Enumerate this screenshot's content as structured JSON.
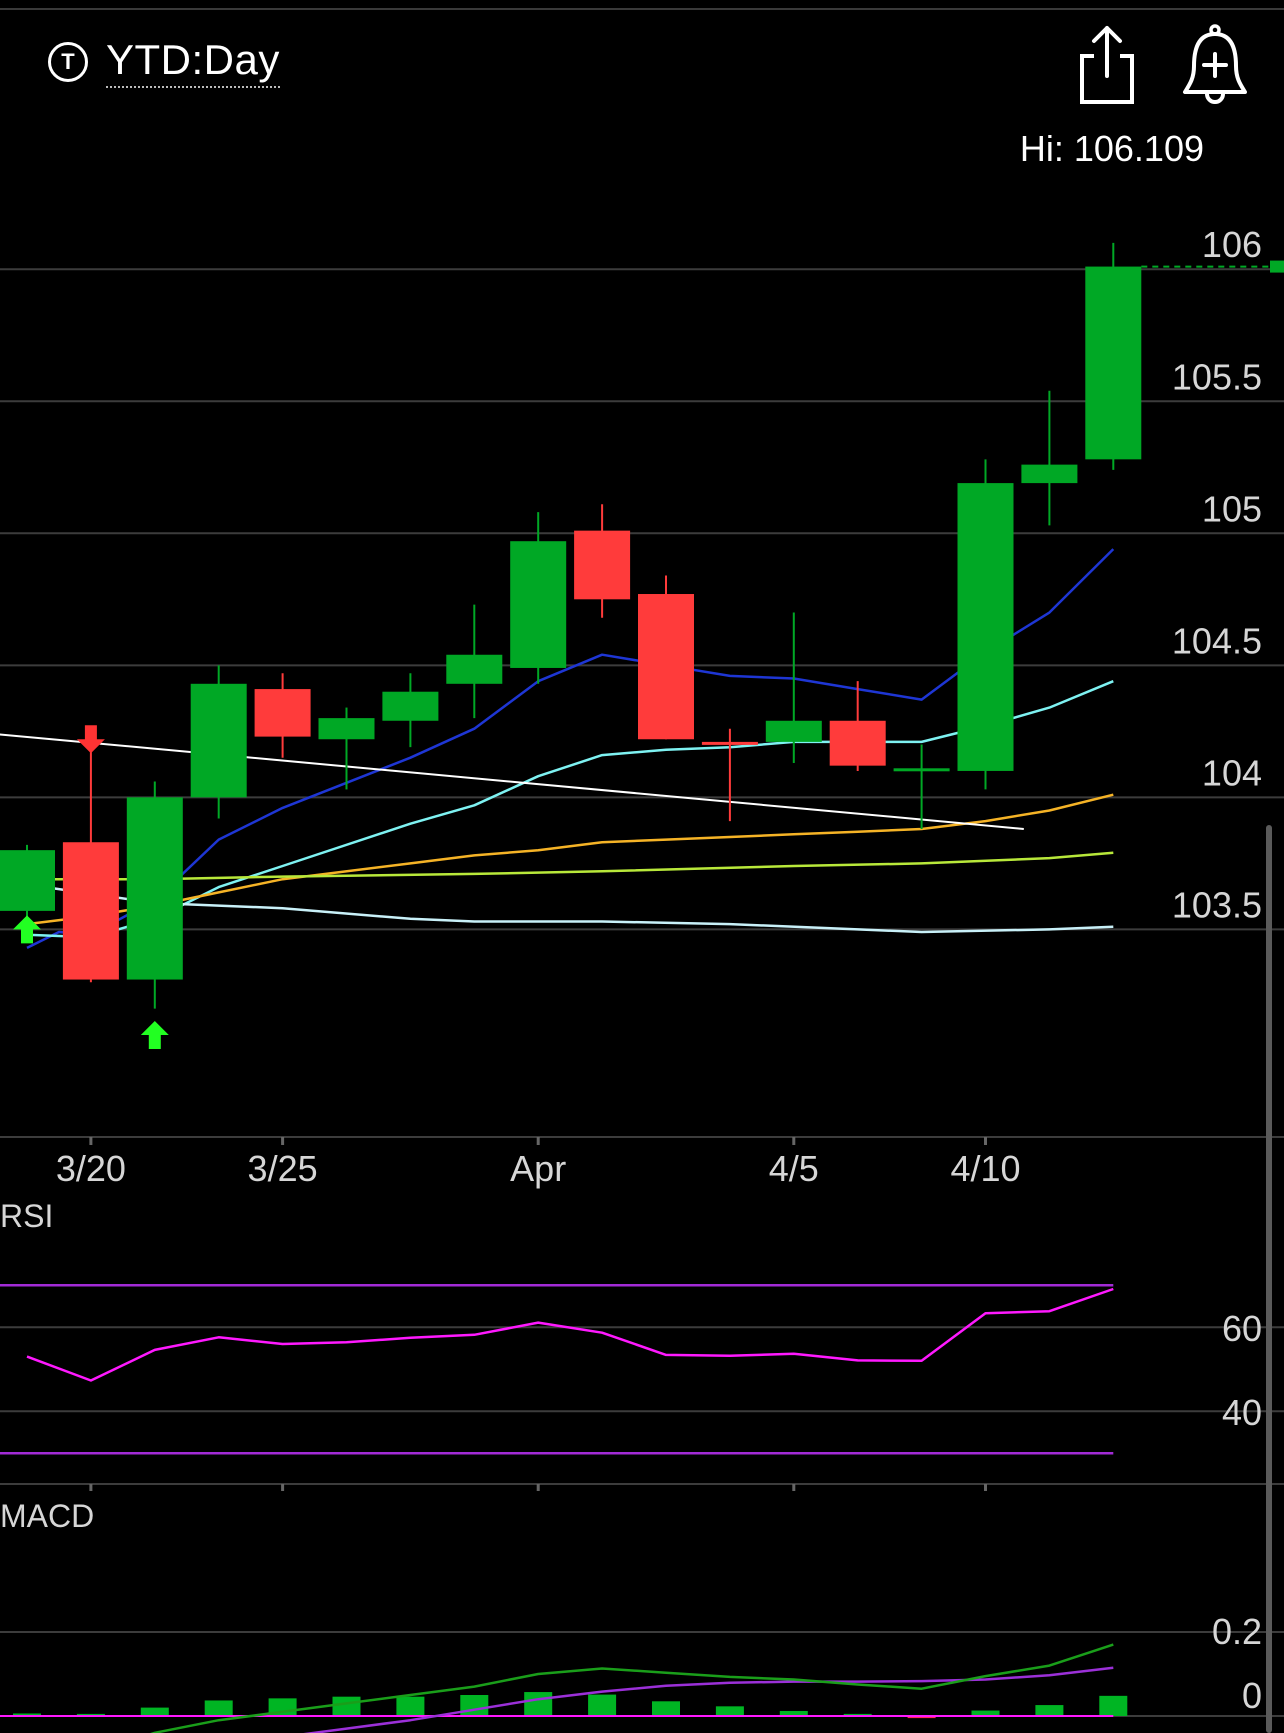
{
  "header": {
    "timezone_icon": "T",
    "period_label": "YTD:Day",
    "share_icon": "share-icon",
    "alert_icon": "add-alert-bell-icon"
  },
  "hi_label": "Hi: 106.109",
  "colors": {
    "up": "#00a825",
    "down": "#ff3b3b",
    "grid": "#3c3c3c",
    "ma_blue": "#1e36d4",
    "ma_cyan": "#7ef2f2",
    "ma_orange": "#f5b326",
    "ma_lime": "#b8e83a",
    "ma_paleblue": "#c8f0f8",
    "trendline": "#ffffff",
    "rsi": "#ff19ff",
    "rsi_bounds": "#a22bd6",
    "macd": "#1a9e1a",
    "macd_signal": "#9b30d8",
    "macd_hist_up": "#00b523",
    "macd_hist_down": "#ff2a55",
    "signal_up_arrow": "#22ff22",
    "signal_down_arrow": "#ff3333"
  },
  "chart_data": [
    {
      "type": "candlestick",
      "x_labels": [
        "3/20",
        "3/25",
        "Apr",
        "4/5",
        "4/10"
      ],
      "x_label_positions": [
        1,
        4,
        8,
        12,
        15
      ],
      "y_ticks": [
        "106",
        "105.5",
        "105",
        "104.5",
        "104",
        "103.5"
      ],
      "ylim": [
        103.1,
        106.3
      ],
      "candles": [
        {
          "i": 0,
          "o": 103.57,
          "h": 103.82,
          "l": 103.47,
          "c": 103.8
        },
        {
          "i": 1,
          "o": 103.83,
          "h": 104.2,
          "l": 103.3,
          "c": 103.31
        },
        {
          "i": 2,
          "o": 103.31,
          "h": 104.06,
          "l": 103.2,
          "c": 104.0
        },
        {
          "i": 3,
          "o": 104.0,
          "h": 104.5,
          "l": 103.92,
          "c": 104.43
        },
        {
          "i": 4,
          "o": 104.41,
          "h": 104.47,
          "l": 104.15,
          "c": 104.23
        },
        {
          "i": 5,
          "o": 104.22,
          "h": 104.34,
          "l": 104.03,
          "c": 104.3
        },
        {
          "i": 6,
          "o": 104.29,
          "h": 104.47,
          "l": 104.19,
          "c": 104.4
        },
        {
          "i": 7,
          "o": 104.43,
          "h": 104.73,
          "l": 104.3,
          "c": 104.54
        },
        {
          "i": 8,
          "o": 104.49,
          "h": 105.08,
          "l": 104.43,
          "c": 104.97
        },
        {
          "i": 9,
          "o": 105.01,
          "h": 105.11,
          "l": 104.68,
          "c": 104.75
        },
        {
          "i": 10,
          "o": 104.77,
          "h": 104.84,
          "l": 104.22,
          "c": 104.22
        },
        {
          "i": 11,
          "o": 104.21,
          "h": 104.26,
          "l": 103.91,
          "c": 104.2
        },
        {
          "i": 12,
          "o": 104.21,
          "h": 104.7,
          "l": 104.13,
          "c": 104.29
        },
        {
          "i": 13,
          "o": 104.29,
          "h": 104.44,
          "l": 104.1,
          "c": 104.12
        },
        {
          "i": 14,
          "o": 104.1,
          "h": 104.2,
          "l": 103.88,
          "c": 104.11
        },
        {
          "i": 15,
          "o": 104.1,
          "h": 105.28,
          "l": 104.03,
          "c": 105.19
        },
        {
          "i": 16,
          "o": 105.19,
          "h": 105.54,
          "l": 105.03,
          "c": 105.26
        },
        {
          "i": 17,
          "o": 105.28,
          "h": 106.1,
          "l": 105.24,
          "c": 106.01
        }
      ],
      "moving_averages": [
        {
          "color_key": "ma_blue",
          "points": [
            [
              0,
              103.43
            ],
            [
              0.5,
              103.49
            ],
            [
              1,
              103.48
            ],
            [
              2,
              103.61
            ],
            [
              3,
              103.84
            ],
            [
              4,
              103.96
            ],
            [
              6,
              104.15
            ],
            [
              7,
              104.26
            ],
            [
              8,
              104.44
            ],
            [
              9,
              104.54
            ],
            [
              10,
              104.5
            ],
            [
              11,
              104.46
            ],
            [
              12,
              104.45
            ],
            [
              13,
              104.41
            ],
            [
              14,
              104.37
            ],
            [
              15,
              104.55
            ],
            [
              16,
              104.7
            ],
            [
              17,
              104.94
            ]
          ]
        },
        {
          "color_key": "ma_cyan",
          "points": [
            [
              0,
              103.48
            ],
            [
              1,
              103.47
            ],
            [
              2,
              103.54
            ],
            [
              3,
              103.66
            ],
            [
              4,
              103.74
            ],
            [
              6,
              103.9
            ],
            [
              7,
              103.97
            ],
            [
              8,
              104.08
            ],
            [
              9,
              104.16
            ],
            [
              10,
              104.18
            ],
            [
              11,
              104.19
            ],
            [
              12,
              104.21
            ],
            [
              13,
              104.21
            ],
            [
              14,
              104.21
            ],
            [
              15,
              104.27
            ],
            [
              16,
              104.34
            ],
            [
              17,
              104.44
            ]
          ]
        },
        {
          "color_key": "ma_orange",
          "points": [
            [
              0,
              103.52
            ],
            [
              1,
              103.55
            ],
            [
              2,
              103.59
            ],
            [
              3,
              103.64
            ],
            [
              4,
              103.69
            ],
            [
              6,
              103.75
            ],
            [
              7,
              103.78
            ],
            [
              8,
              103.8
            ],
            [
              9,
              103.83
            ],
            [
              10,
              103.84
            ],
            [
              11,
              103.85
            ],
            [
              12,
              103.86
            ],
            [
              13,
              103.87
            ],
            [
              14,
              103.88
            ],
            [
              15,
              103.91
            ],
            [
              16,
              103.95
            ],
            [
              17,
              104.01
            ]
          ]
        },
        {
          "color_key": "ma_lime",
          "points": [
            [
              0,
              103.69
            ],
            [
              2,
              103.69
            ],
            [
              4,
              103.7
            ],
            [
              7,
              103.71
            ],
            [
              9,
              103.72
            ],
            [
              12,
              103.74
            ],
            [
              14,
              103.75
            ],
            [
              16,
              103.77
            ],
            [
              17,
              103.79
            ]
          ]
        },
        {
          "color_key": "ma_paleblue",
          "points": [
            [
              0,
              103.67
            ],
            [
              2,
              103.6
            ],
            [
              4,
              103.58
            ],
            [
              6,
              103.54
            ],
            [
              7,
              103.53
            ],
            [
              9,
              103.53
            ],
            [
              11,
              103.52
            ],
            [
              13,
              103.5
            ],
            [
              14,
              103.49
            ],
            [
              16,
              103.5
            ],
            [
              17,
              103.51
            ]
          ]
        }
      ],
      "trendline": [
        [
          -0.5,
          104.24
        ],
        [
          15.6,
          103.88
        ]
      ],
      "signals": [
        {
          "i": 0,
          "dir": "up",
          "y": 103.5
        },
        {
          "i": 1,
          "dir": "down",
          "y": 104.22
        },
        {
          "i": 2,
          "dir": "up",
          "y": 103.1
        }
      ]
    },
    {
      "type": "line",
      "title": "RSI",
      "y_ticks": [
        60,
        40
      ],
      "ylim": [
        26,
        76
      ],
      "bounds": [
        70,
        30
      ],
      "values": [
        53.0,
        47.3,
        54.6,
        57.6,
        56.0,
        56.4,
        57.5,
        58.2,
        61.1,
        58.7,
        53.4,
        53.2,
        53.7,
        52.1,
        52.0,
        63.3,
        63.8,
        69.1
      ]
    },
    {
      "type": "line+bar",
      "title": "MACD",
      "y_ticks": [
        0.2,
        0
      ],
      "ylim": [
        -0.05,
        0.35
      ],
      "macd": [
        -0.12,
        -0.09,
        -0.04,
        -0.01,
        0.01,
        0.03,
        0.05,
        0.07,
        0.1,
        0.113,
        0.103,
        0.093,
        0.087,
        0.075,
        0.065,
        0.095,
        0.12,
        0.17
      ],
      "signal": [
        -0.14,
        -0.125,
        -0.1,
        -0.08,
        -0.05,
        -0.03,
        -0.01,
        0.015,
        0.04,
        0.058,
        0.072,
        0.079,
        0.082,
        0.082,
        0.083,
        0.087,
        0.097,
        0.115
      ],
      "histogram": [
        0.006,
        0.005,
        0.02,
        0.037,
        0.042,
        0.046,
        0.046,
        0.05,
        0.057,
        0.051,
        0.035,
        0.023,
        0.012,
        0.005,
        -0.005,
        0.013,
        0.026,
        0.048
      ]
    }
  ]
}
